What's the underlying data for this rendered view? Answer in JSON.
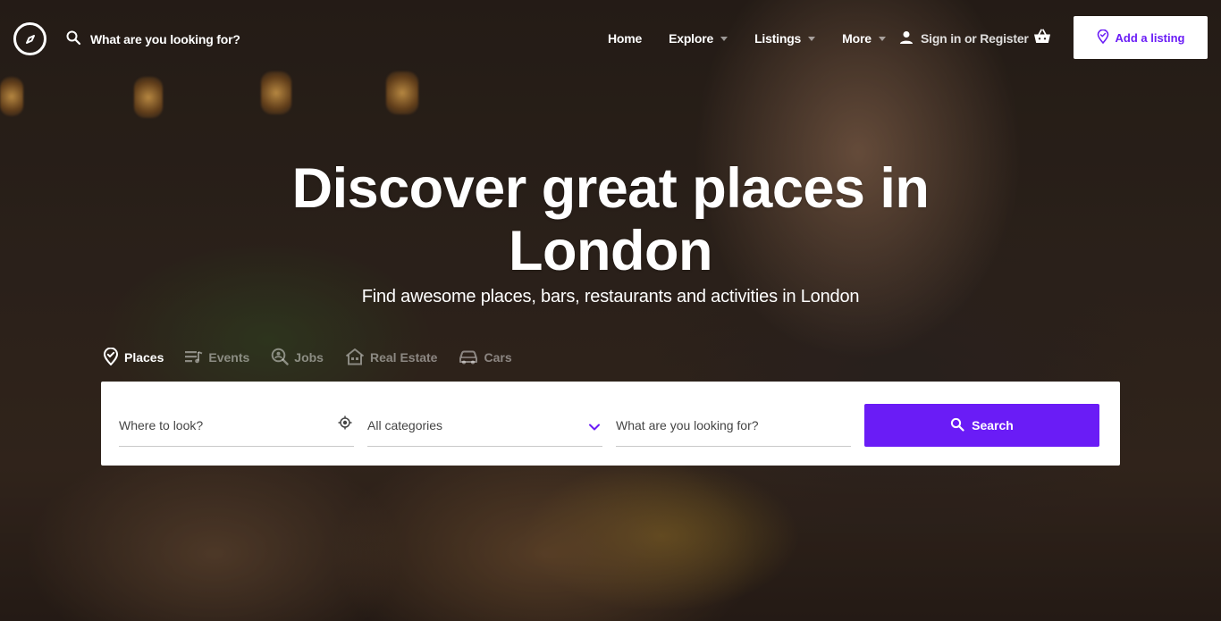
{
  "nav": {
    "search_placeholder": "What are you looking for?",
    "links": [
      {
        "label": "Home",
        "has_dropdown": false
      },
      {
        "label": "Explore",
        "has_dropdown": true
      },
      {
        "label": "Listings",
        "has_dropdown": true
      },
      {
        "label": "More",
        "has_dropdown": true
      }
    ],
    "signin_label": "Sign in or Register",
    "add_listing_label": "Add a listing",
    "icons": [
      "compass-logo-icon",
      "search-icon",
      "user-icon",
      "basket-icon",
      "map-pin-icon"
    ]
  },
  "hero": {
    "headline_line1": "Discover great places in",
    "headline_line2": "London",
    "subheadline": "Find awesome places, bars, restaurants and activities in London"
  },
  "tabs": [
    {
      "label": "Places",
      "icon": "map-pin-icon",
      "active": true
    },
    {
      "label": "Events",
      "icon": "event-list-icon",
      "active": false
    },
    {
      "label": "Jobs",
      "icon": "job-search-icon",
      "active": false
    },
    {
      "label": "Real Estate",
      "icon": "house-icon",
      "active": false
    },
    {
      "label": "Cars",
      "icon": "car-icon",
      "active": false
    }
  ],
  "search_form": {
    "location_placeholder": "Where to look?",
    "category_value": "All categories",
    "keyword_placeholder": "What are you looking for?",
    "search_label": "Search"
  },
  "colors": {
    "accent": "#6a1cf6",
    "text_on_dark": "#ffffff",
    "field_text": "#444444"
  }
}
